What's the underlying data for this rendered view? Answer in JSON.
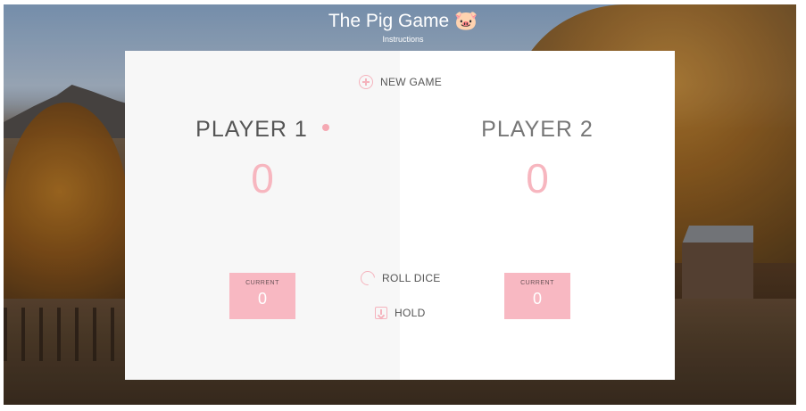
{
  "header": {
    "title": "The Pig Game 🐷",
    "subtitle": "Instructions"
  },
  "controls": {
    "new_game": "NEW GAME",
    "roll_dice": "ROLL DICE",
    "hold": "HOLD"
  },
  "players": [
    {
      "name": "PLAYER 1",
      "score": "0",
      "current_label": "CURRENT",
      "current_score": "0",
      "active": true
    },
    {
      "name": "PLAYER 2",
      "score": "0",
      "current_label": "CURRENT",
      "current_score": "0",
      "active": false
    }
  ],
  "colors": {
    "accent_pink": "#f8b8c2",
    "active_panel": "#f7f7f7",
    "inactive_panel": "#ffffff"
  }
}
